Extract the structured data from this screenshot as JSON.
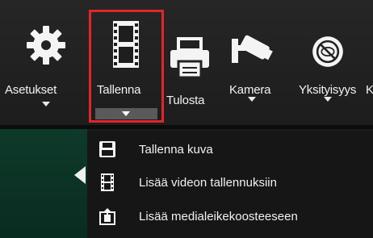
{
  "toolbar": {
    "items": [
      {
        "label": "Asetukset",
        "icon": "gear-icon"
      },
      {
        "label": "Tallenna",
        "icon": "film-icon"
      },
      {
        "label": "Tulosta",
        "icon": "printer-icon"
      },
      {
        "label": "Kamera",
        "icon": "security-camera-icon"
      },
      {
        "label": "Yksityisyys",
        "icon": "privacy-icon"
      },
      {
        "label": "K",
        "icon": ""
      }
    ],
    "selected_item": "Tallenna",
    "highlight_color": "#e0262a"
  },
  "menu": {
    "items": [
      {
        "label": "Tallenna kuva",
        "icon": "floppy-disk-icon"
      },
      {
        "label": "Lisää videon tallennuksiin",
        "icon": "film-strip-icon"
      },
      {
        "label": "Lisää medialeikekoosteeseen",
        "icon": "media-clip-icon"
      }
    ]
  },
  "sidebar": {
    "icon": "collapse-arrow-icon",
    "color": "#0e3a2a"
  }
}
